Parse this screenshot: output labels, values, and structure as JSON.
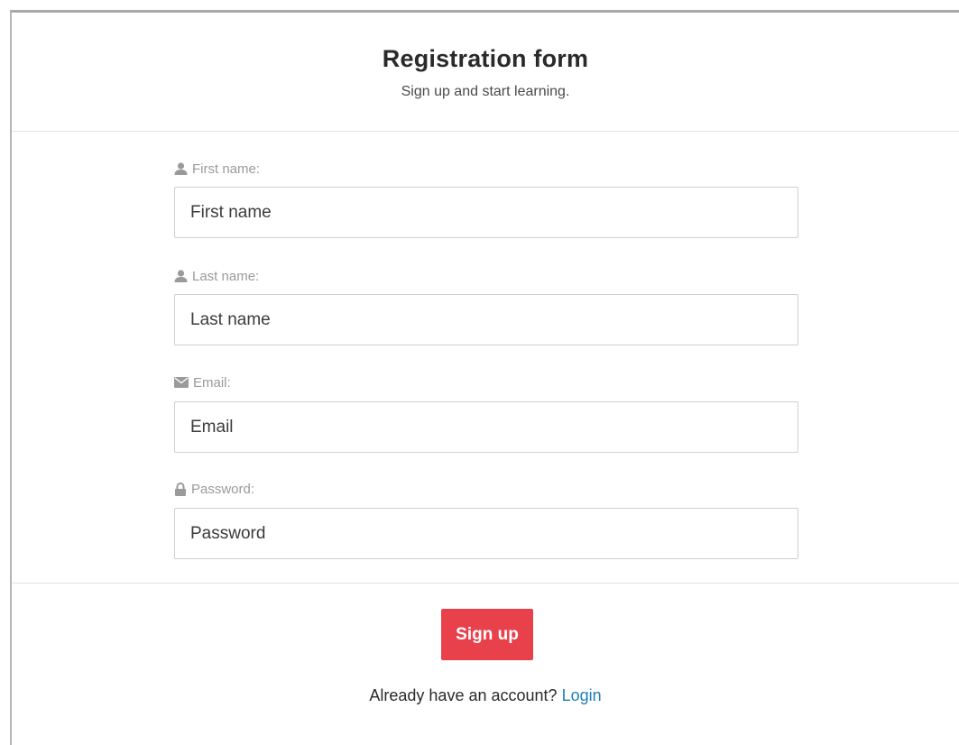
{
  "header": {
    "title": "Registration form",
    "subtitle": "Sign up and start learning."
  },
  "form": {
    "fields": [
      {
        "label": "First name:",
        "placeholder": "First name",
        "value": "",
        "icon": "user-icon"
      },
      {
        "label": "Last name:",
        "placeholder": "Last name",
        "value": "",
        "icon": "user-icon"
      },
      {
        "label": "Email:",
        "placeholder": "Email",
        "value": "",
        "icon": "envelope-icon"
      },
      {
        "label": "Password:",
        "placeholder": "Password",
        "value": "",
        "icon": "lock-icon"
      }
    ]
  },
  "footer": {
    "signup_label": "Sign up",
    "account_prompt": "Already have an account?",
    "login_label": "Login"
  },
  "colors": {
    "accent": "#e9414c",
    "link": "#1f7fb6",
    "label": "#9a9a9a"
  }
}
